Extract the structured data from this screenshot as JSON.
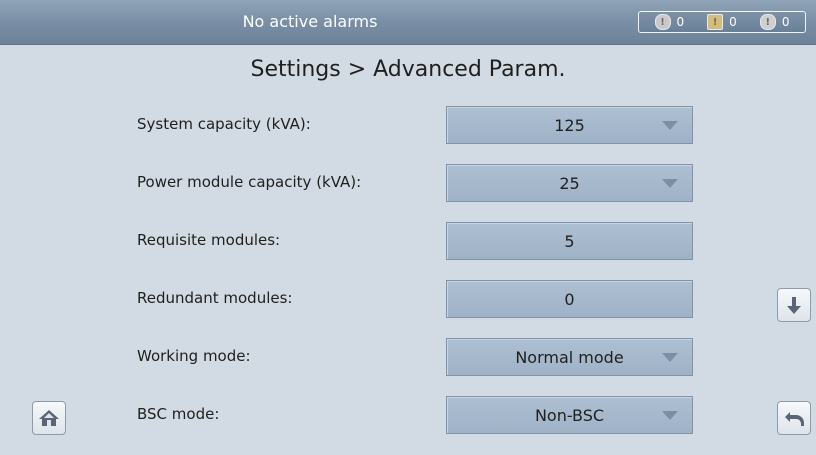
{
  "status_bar": {
    "alarm_text": "No active alarms",
    "counts": {
      "critical": "0",
      "major": "0",
      "minor": "0"
    }
  },
  "page": {
    "title": "Settings > Advanced Param."
  },
  "rows": [
    {
      "label": "System capacity (kVA):",
      "value": "125",
      "type": "dropdown"
    },
    {
      "label": "Power module capacity (kVA):",
      "value": "25",
      "type": "dropdown"
    },
    {
      "label": "Requisite modules:",
      "value": "5",
      "type": "input"
    },
    {
      "label": "Redundant modules:",
      "value": "0",
      "type": "input"
    },
    {
      "label": "Working mode:",
      "value": "Normal mode",
      "type": "dropdown"
    },
    {
      "label": "BSC mode:",
      "value": "Non-BSC",
      "type": "dropdown"
    }
  ],
  "icons": {
    "home": "home-icon",
    "scroll_down": "arrow-down-icon",
    "back": "back-arrow-icon"
  },
  "colors": {
    "background": "#d2dbe3",
    "topbar": "#7a8fa6",
    "field": "#a7b9cd"
  }
}
